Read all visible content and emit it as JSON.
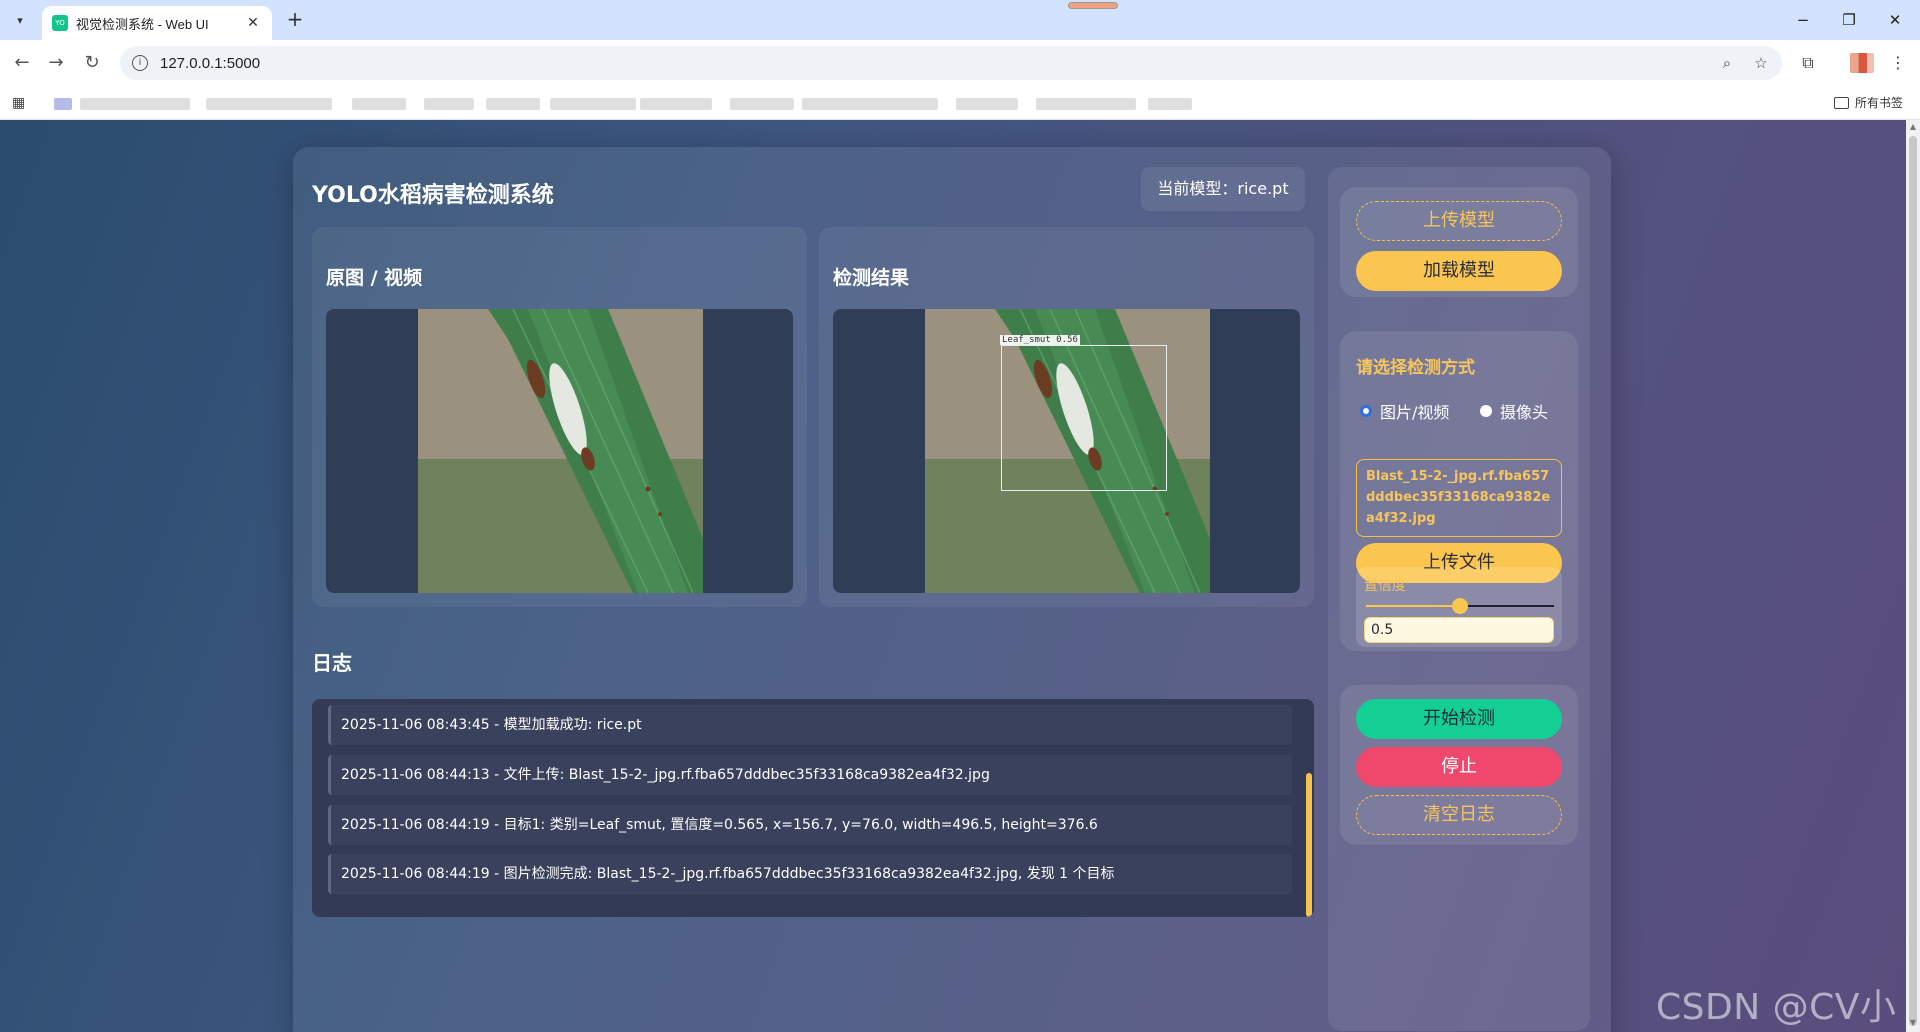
{
  "browser": {
    "tab_title": "视觉检测系统 - Web UI",
    "favicon_text": "YO",
    "url": "127.0.0.1:5000",
    "bookmarks_all_label": "所有书签"
  },
  "app": {
    "title": "YOLO水稻病害检测系统",
    "model_label": "当前模型：rice.pt",
    "source_panel_title": "原图 / 视频",
    "result_panel_title": "检测结果",
    "detection": {
      "class_name": "Leaf_smut",
      "confidence_text": "0.56",
      "label": "Leaf_smut  0.56"
    },
    "log_title": "日志",
    "logs": [
      "2025-11-06 08:43:45 - 模型加载成功: rice.pt",
      "2025-11-06 08:44:13 - 文件上传: Blast_15-2-_jpg.rf.fba657dddbec35f33168ca9382ea4f32.jpg",
      "2025-11-06 08:44:19 - 目标1: 类别=Leaf_smut, 置信度=0.565, x=156.7, y=76.0, width=496.5, height=376.6",
      "2025-11-06 08:44:19 - 图片检测完成: Blast_15-2-_jpg.rf.fba657dddbec35f33168ca9382ea4f32.jpg, 发现 1 个目标"
    ]
  },
  "sidebar": {
    "upload_model_label": "上传模型",
    "load_model_label": "加载模型",
    "mode_title": "请选择检测方式",
    "mode_options": [
      "图片/视频",
      "摄像头"
    ],
    "selected_mode": "图片/视频",
    "file_name": "Blast_15-2-_jpg.rf.fba657dddbec35f33168ca9382ea4f32.jpg",
    "upload_file_label": "上传文件",
    "confidence_label": "置信度",
    "confidence_value": "0.5",
    "confidence_fraction": 0.5,
    "start_label": "开始检测",
    "stop_label": "停止",
    "clear_log_label": "清空日志"
  },
  "watermark": "CSDN @CV小涵",
  "colors": {
    "accent_yellow": "#fbc650",
    "start_green": "#13cf94",
    "stop_red": "#f0486c",
    "log_bg": "#323a56"
  }
}
